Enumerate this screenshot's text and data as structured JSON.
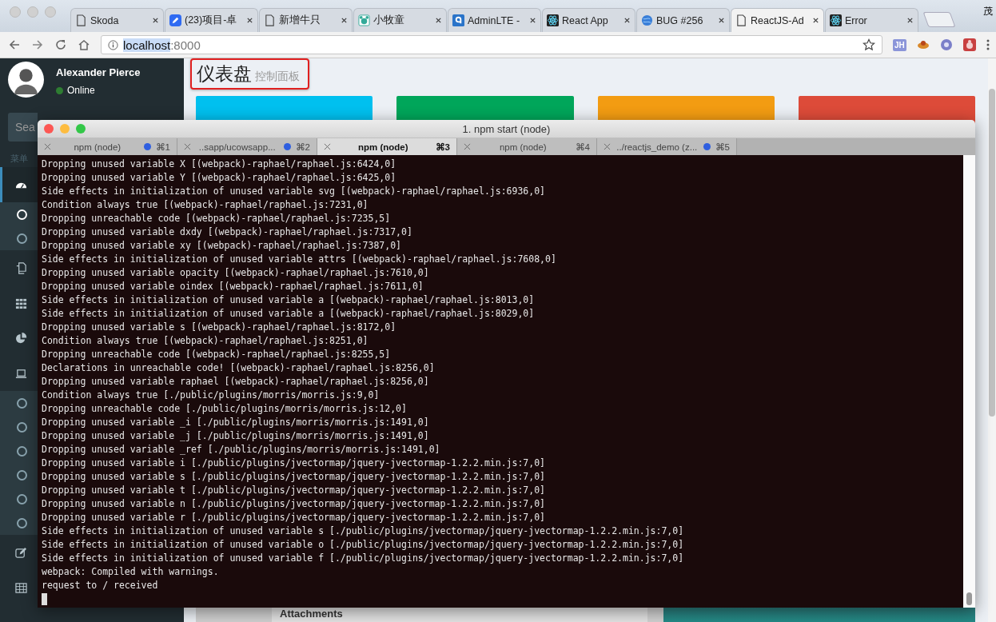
{
  "browser": {
    "tabs": [
      {
        "title": "Skoda",
        "selected": false
      },
      {
        "title": "(23)项目-卓",
        "selected": false
      },
      {
        "title": "新增牛只",
        "selected": false
      },
      {
        "title": "小牧童",
        "selected": false
      },
      {
        "title": "AdminLTE -",
        "selected": false
      },
      {
        "title": "React App",
        "selected": false
      },
      {
        "title": "BUG #256",
        "selected": false
      },
      {
        "title": "ReactJS-Ad",
        "selected": true
      },
      {
        "title": "Error",
        "selected": false
      }
    ],
    "profile": "茂",
    "url": {
      "host": "localhost",
      "port": ":8000"
    },
    "extension_badge": "JH"
  },
  "sidebar": {
    "user": {
      "name": "Alexander Pierce",
      "status": "Online"
    },
    "search": {
      "placeholder": "Sea"
    },
    "header": "菜单",
    "items": [
      {
        "selected": true,
        "children": [
          {
            "selected": true
          },
          {
            "selected": false
          }
        ]
      },
      {
        "selected": false
      },
      {
        "selected": false
      },
      {
        "selected": false
      },
      {
        "selected": false,
        "children": [
          {
            "selected": false
          },
          {
            "selected": false
          },
          {
            "selected": false
          },
          {
            "selected": false
          },
          {
            "selected": false
          },
          {
            "selected": false
          }
        ]
      },
      {
        "selected": false
      },
      {
        "selected": false
      }
    ]
  },
  "content": {
    "title": "仪表盘",
    "subtitle": "控制面板",
    "info_boxes": [
      {
        "color": "#00c0ef"
      },
      {
        "color": "#00a65a"
      },
      {
        "color": "#f39c12"
      },
      {
        "color": "#dd4b39"
      }
    ],
    "attachments_label": "Attachments"
  },
  "terminal": {
    "title": "1. npm start (node)",
    "tabs": [
      {
        "title": "npm (node)",
        "shortcut": "⌘1",
        "activity": true,
        "selected": false
      },
      {
        "title": "..sapp/ucowsapp...",
        "shortcut": "⌘2",
        "activity": true,
        "selected": false
      },
      {
        "title": "npm (node)",
        "shortcut": "⌘3",
        "activity": false,
        "selected": true
      },
      {
        "title": "npm (node)",
        "shortcut": "⌘4",
        "activity": false,
        "selected": false
      },
      {
        "title": "../reactjs_demo (z...",
        "shortcut": "⌘5",
        "activity": true,
        "selected": false
      }
    ],
    "lines": [
      "Dropping unused variable X [(webpack)-raphael/raphael.js:6424,0]",
      "Dropping unused variable Y [(webpack)-raphael/raphael.js:6425,0]",
      "Side effects in initialization of unused variable svg [(webpack)-raphael/raphael.js:6936,0]",
      "Condition always true [(webpack)-raphael/raphael.js:7231,0]",
      "Dropping unreachable code [(webpack)-raphael/raphael.js:7235,5]",
      "Dropping unused variable dxdy [(webpack)-raphael/raphael.js:7317,0]",
      "Dropping unused variable xy [(webpack)-raphael/raphael.js:7387,0]",
      "Side effects in initialization of unused variable attrs [(webpack)-raphael/raphael.js:7608,0]",
      "Dropping unused variable opacity [(webpack)-raphael/raphael.js:7610,0]",
      "Dropping unused variable oindex [(webpack)-raphael/raphael.js:7611,0]",
      "Side effects in initialization of unused variable a [(webpack)-raphael/raphael.js:8013,0]",
      "Side effects in initialization of unused variable a [(webpack)-raphael/raphael.js:8029,0]",
      "Dropping unused variable s [(webpack)-raphael/raphael.js:8172,0]",
      "Condition always true [(webpack)-raphael/raphael.js:8251,0]",
      "Dropping unreachable code [(webpack)-raphael/raphael.js:8255,5]",
      "Declarations in unreachable code! [(webpack)-raphael/raphael.js:8256,0]",
      "Dropping unused variable raphael [(webpack)-raphael/raphael.js:8256,0]",
      "Condition always true [./public/plugins/morris/morris.js:9,0]",
      "Dropping unreachable code [./public/plugins/morris/morris.js:12,0]",
      "Dropping unused variable _i [./public/plugins/morris/morris.js:1491,0]",
      "Dropping unused variable _j [./public/plugins/morris/morris.js:1491,0]",
      "Dropping unused variable _ref [./public/plugins/morris/morris.js:1491,0]",
      "Dropping unused variable i [./public/plugins/jvectormap/jquery-jvectormap-1.2.2.min.js:7,0]",
      "Dropping unused variable s [./public/plugins/jvectormap/jquery-jvectormap-1.2.2.min.js:7,0]",
      "Dropping unused variable t [./public/plugins/jvectormap/jquery-jvectormap-1.2.2.min.js:7,0]",
      "Dropping unused variable n [./public/plugins/jvectormap/jquery-jvectormap-1.2.2.min.js:7,0]",
      "Dropping unused variable r [./public/plugins/jvectormap/jquery-jvectormap-1.2.2.min.js:7,0]",
      "Side effects in initialization of unused variable s [./public/plugins/jvectormap/jquery-jvectormap-1.2.2.min.js:7,0]",
      "Side effects in initialization of unused variable o [./public/plugins/jvectormap/jquery-jvectormap-1.2.2.min.js:7,0]",
      "Side effects in initialization of unused variable f [./public/plugins/jvectormap/jquery-jvectormap-1.2.2.min.js:7,0]",
      "webpack: Compiled with warnings.",
      "request to / received"
    ]
  }
}
